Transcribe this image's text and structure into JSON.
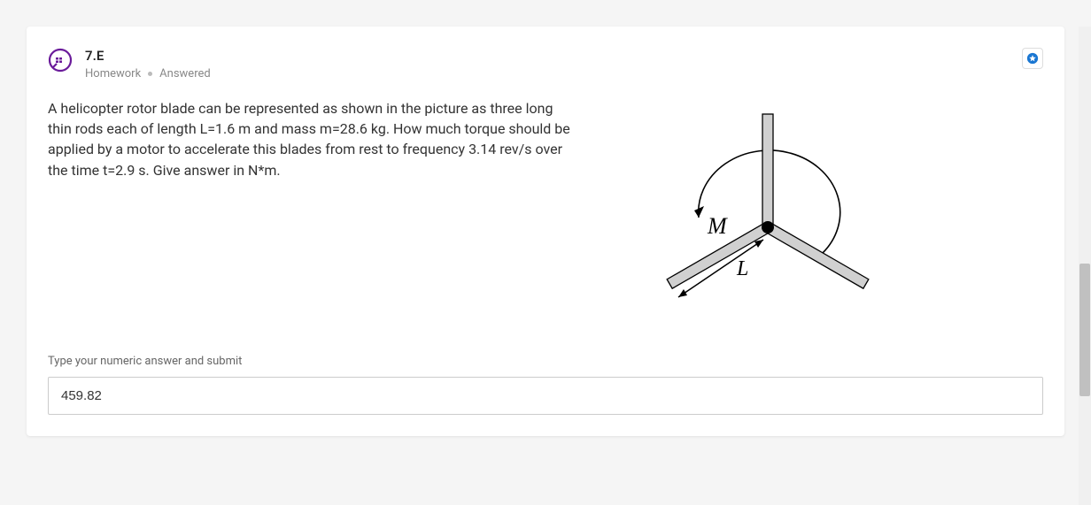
{
  "question": {
    "number": "7.E",
    "category": "Homework",
    "status": "Answered",
    "body": "A helicopter rotor blade can be represented as shown in the picture as three long thin rods each of length L=1.6 m and mass m=28.6 kg. How much torque should be applied by a motor to accelerate this blades from rest to frequency 3.14 rev/s over the time t=2.9 s. Give answer in N*m."
  },
  "input": {
    "label": "Type your numeric answer and submit",
    "value": "459.82"
  },
  "diagram": {
    "label_mass": "M",
    "label_length": "L"
  }
}
